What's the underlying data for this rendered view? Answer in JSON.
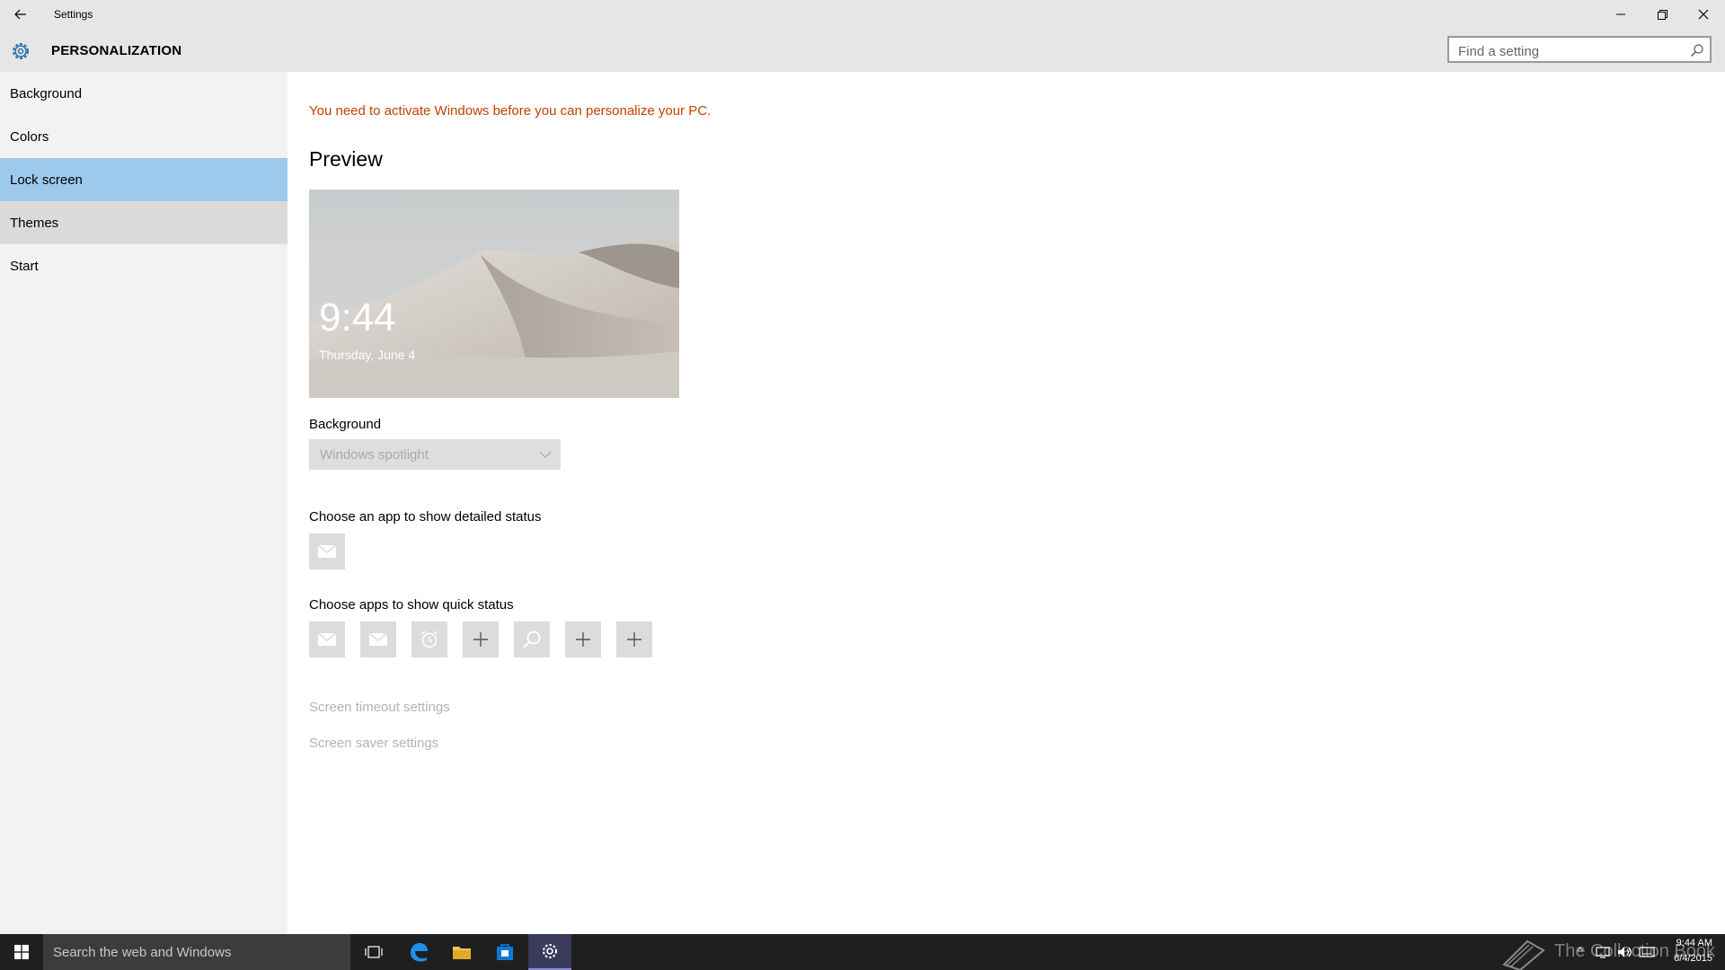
{
  "window": {
    "title": "Settings",
    "header_title": "PERSONALIZATION",
    "search_placeholder": "Find a setting"
  },
  "sidebar": {
    "items": [
      {
        "label": "Background"
      },
      {
        "label": "Colors"
      },
      {
        "label": "Lock screen",
        "selected": true
      },
      {
        "label": "Themes"
      },
      {
        "label": "Start"
      }
    ]
  },
  "main": {
    "warning": "You need to activate Windows before you can personalize your PC.",
    "preview_heading": "Preview",
    "preview_time": "9:44",
    "preview_date": "Thursday, June 4",
    "background_label": "Background",
    "background_value": "Windows spotlight",
    "detailed_status_label": "Choose an app to show detailed status",
    "quick_status_label": "Choose apps to show quick status",
    "quick_status_icons": [
      "mail-icon",
      "mail-icon",
      "alarm-icon",
      "plus-icon",
      "search-icon",
      "plus-icon",
      "plus-icon"
    ],
    "screen_timeout_link": "Screen timeout settings",
    "screen_saver_link": "Screen saver settings"
  },
  "taskbar": {
    "search_text": "Search the web and Windows",
    "time": "9:44 AM",
    "date": "6/4/2015",
    "watermark": "The Collection Book"
  },
  "colors": {
    "selected_nav": "#9dc9ec",
    "warning": "#c24100",
    "accent_gear": "#2b6cb0"
  }
}
